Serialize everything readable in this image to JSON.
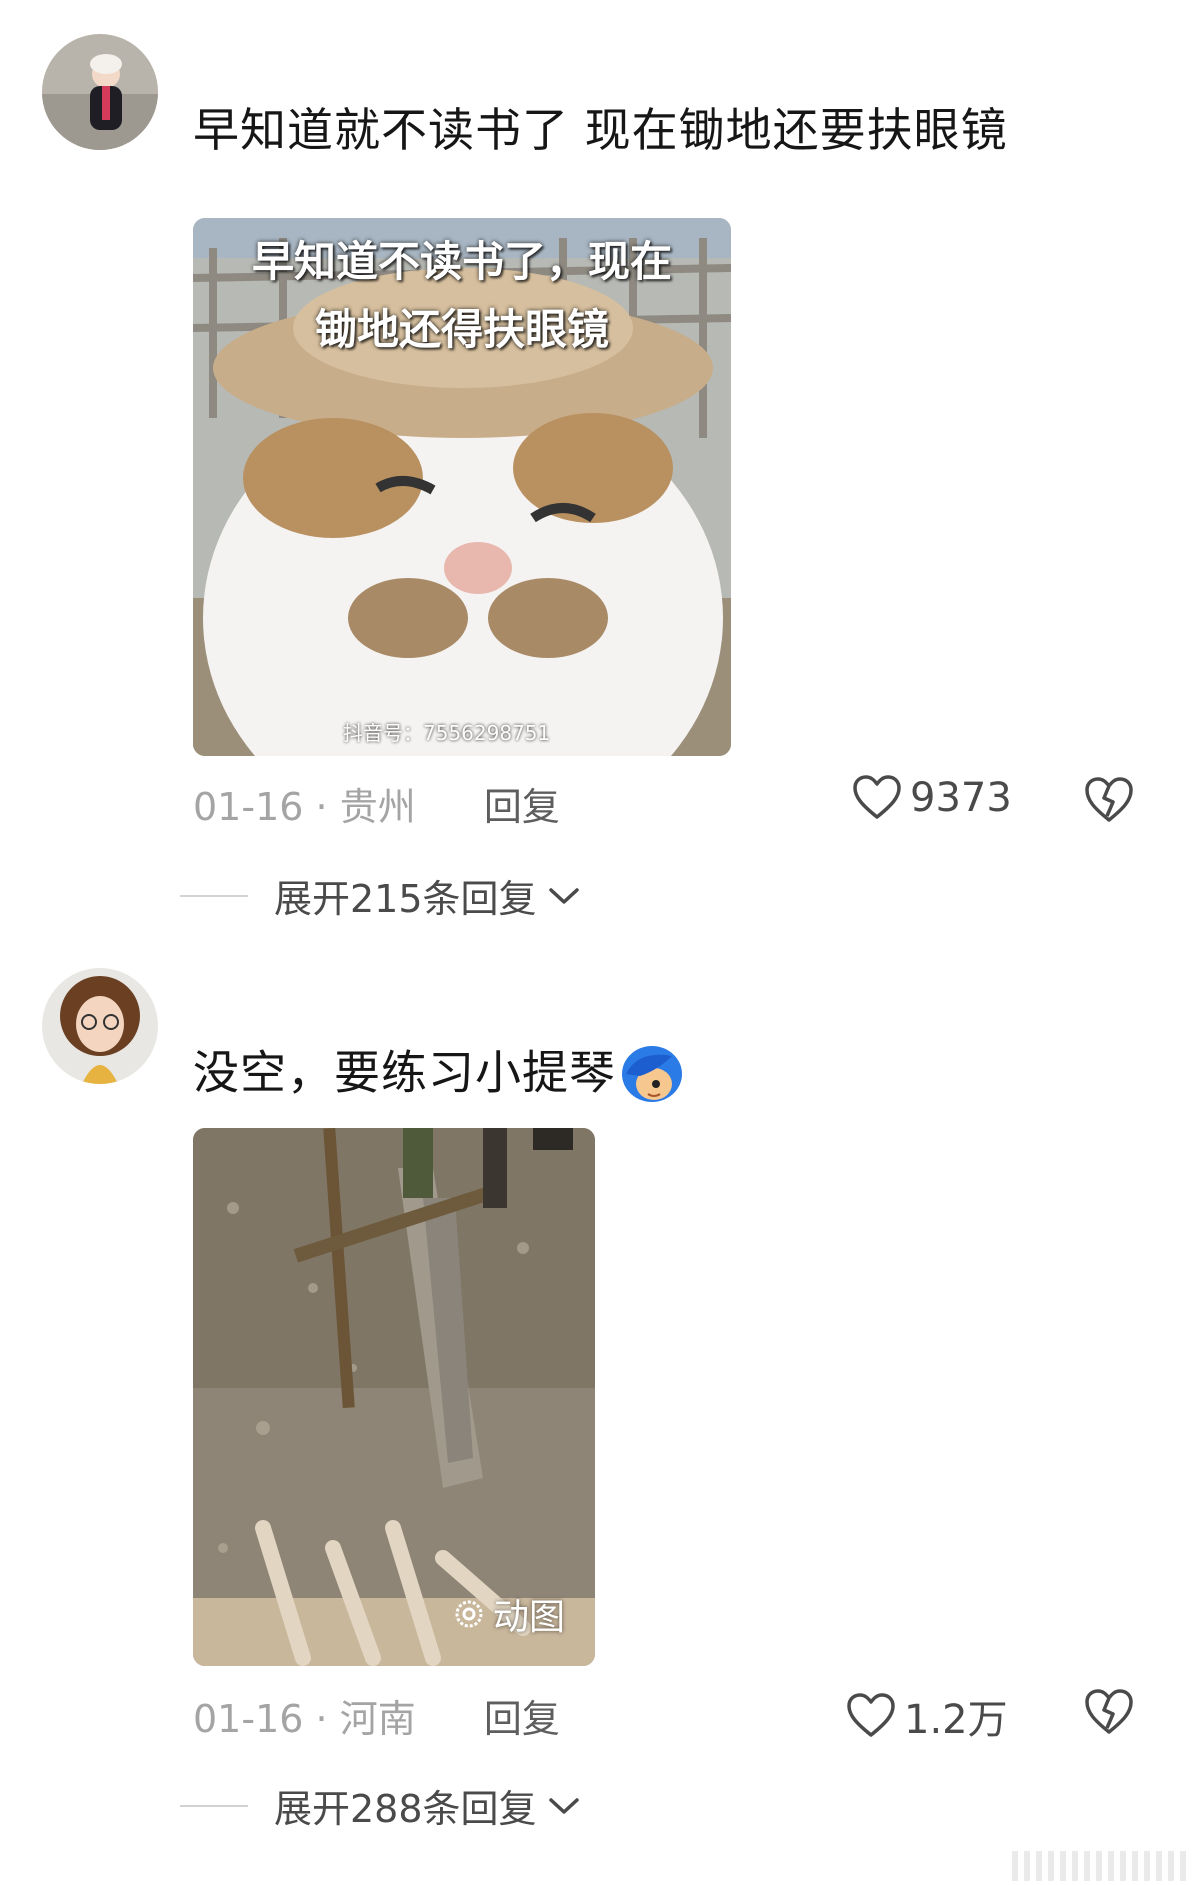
{
  "comments": [
    {
      "text": "早知道就不读书了  现在锄地还要扶眼镜",
      "image": {
        "caption_line1": "早知道不读书了，现在",
        "caption_line2": "锄地还得扶眼镜",
        "watermark": "抖音号：7556298751"
      },
      "date": "01-16",
      "separator": "·",
      "location": "贵州",
      "reply_label": "回复",
      "likes": "9373",
      "expand_label": "展开215条回复"
    },
    {
      "text": "没空，要练习小提琴",
      "emoji": "blue-hair-face-emoji",
      "image": {
        "gif_label": "动图"
      },
      "date": "01-16",
      "separator": "·",
      "location": "河南",
      "reply_label": "回复",
      "likes": "1.2万",
      "expand_label": "展开288条回复"
    }
  ],
  "colors": {
    "meta_gray": "#a4a4a4",
    "reply_gray": "#5e5e5e",
    "text": "#161616"
  }
}
